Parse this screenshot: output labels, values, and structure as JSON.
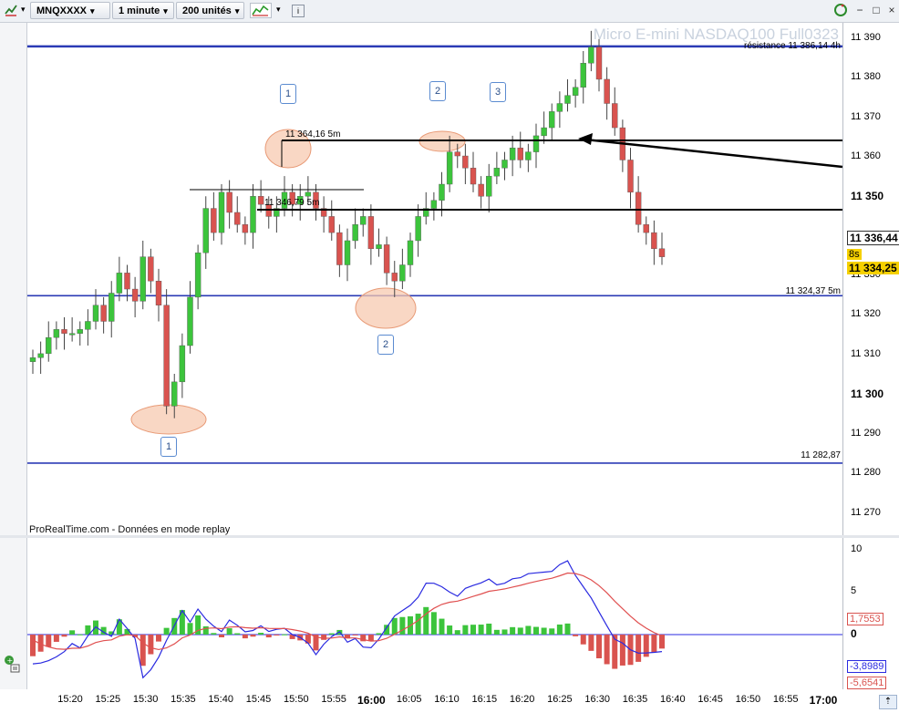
{
  "toolbar": {
    "symbol": "MNQXXXX",
    "interval": "1 minute",
    "units": "200 unités",
    "info_icon": "info-icon",
    "chart_type_icon": "chart-type-icon"
  },
  "chart": {
    "watermark": "Micro E-mini NASDAQ100 Full0323",
    "source": "ProRealTime.com - Données en mode replay",
    "price_axis": [
      "11 390",
      "11 380",
      "11 370",
      "11 360",
      "11 350",
      "11 340",
      "11 330",
      "11 320",
      "11 310",
      "11 300",
      "11 290",
      "11 280",
      "11 270"
    ],
    "price_bold": [
      "11 350",
      "11 300"
    ],
    "current_price": "11 336,44",
    "countdown": "8s",
    "last_price": "11 334,25",
    "levels": [
      {
        "label": "résistance  11 386,14 4h",
        "price": 11386.14,
        "color": "#2b3bb5"
      },
      {
        "label": "11 324,37 5m",
        "price": 11324.37,
        "color": "#2b3bb5"
      },
      {
        "label": "11 282,87",
        "price": 11282.87,
        "color": "#2b3bb5"
      }
    ],
    "annotations": {
      "level_1": "11 364,16 5m",
      "level_2": "11 346,79 5m"
    },
    "boxes": [
      "1",
      "1",
      "2",
      "2",
      "3"
    ],
    "time_axis": [
      "15:20",
      "15:25",
      "15:30",
      "15:35",
      "15:40",
      "15:45",
      "15:50",
      "15:55",
      "16:00",
      "16:05",
      "16:10",
      "16:15",
      "16:20",
      "16:25",
      "16:30",
      "16:35",
      "16:40",
      "16:45",
      "16:50",
      "16:55",
      "17:00"
    ],
    "time_bold": [
      "16:00",
      "17:00"
    ],
    "indicator_axis": [
      "10",
      "5",
      "0"
    ],
    "indicator_tags": {
      "signal": "1,7553",
      "macd": "-3,8989",
      "hist": "-5,6541"
    },
    "colors": {
      "up": "#3cc43c",
      "down": "#d9534f",
      "level": "#2b3bb5",
      "macd_line": "#2a2ae0",
      "signal_line": "#e05050",
      "highlight": "#f7c9b0"
    }
  },
  "chart_data": {
    "type": "candlestick",
    "y_range": [
      11265,
      11392
    ],
    "x_range": [
      "15:17",
      "16:40"
    ],
    "candles_close": [
      11309,
      11310,
      11314,
      11316,
      11315,
      11315,
      11316,
      11318,
      11322,
      11318,
      11325,
      11330,
      11326,
      11323,
      11334,
      11328,
      11322,
      11297,
      11303,
      11312,
      11324,
      11335,
      11346,
      11340,
      11350,
      11345,
      11342,
      11340,
      11349,
      11347,
      11344,
      11346,
      11350,
      11347,
      11349,
      11350,
      11346,
      11344,
      11340,
      11332,
      11338,
      11342,
      11344,
      11336,
      11337,
      11330,
      11328,
      11332,
      11338,
      11344,
      11346,
      11348,
      11352,
      11360,
      11359,
      11356,
      11352,
      11349,
      11354,
      11356,
      11358,
      11361,
      11358,
      11360,
      11364,
      11366,
      11370,
      11372,
      11374,
      11376,
      11382,
      11386,
      11378,
      11372,
      11366,
      11358,
      11350,
      11342,
      11340,
      11336,
      11334
    ]
  }
}
